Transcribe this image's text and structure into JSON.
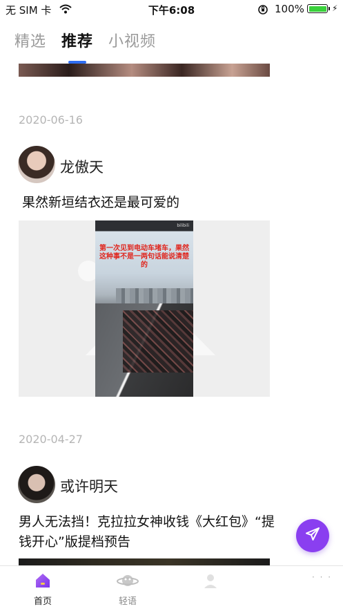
{
  "status_bar": {
    "carrier": "无 SIM 卡",
    "time": "下午6:08",
    "battery_percent": "100%",
    "battery_level": 1.0,
    "colors": {
      "battery": "#3ad13c"
    },
    "icons": [
      "wifi-icon",
      "rotation-lock-icon",
      "battery-icon",
      "charging-bolt-icon"
    ]
  },
  "top_tabs": [
    {
      "label": "精选",
      "active": false
    },
    {
      "label": "推荐",
      "active": true
    },
    {
      "label": "小视频",
      "active": false
    }
  ],
  "feed": {
    "posts": [
      {
        "date": "2020-06-16",
        "username": "龙傲天",
        "caption": "果然新垣结衣还是最可爱的",
        "media_overlay_text": "第一次见到电动车堵车，果然这种事不是一两句话能说清楚的",
        "media_watermark": "bilibili"
      },
      {
        "date": "2020-04-27",
        "username": "或许明天",
        "caption": "男人无法挡！克拉拉女神收钱《大红包》“提钱开心”版提档预告"
      }
    ]
  },
  "fab": {
    "icon": "send-plane-icon",
    "color": "#8a3ff0"
  },
  "bottom_nav": [
    {
      "label": "首页",
      "icon": "home-icon",
      "active": true
    },
    {
      "label": "轻语",
      "icon": "planet-icon",
      "active": false
    },
    {
      "label": "",
      "icon": "profile-icon",
      "active": false
    }
  ],
  "colors": {
    "accent": "#2f6ef2",
    "brand_purple": "#8a3ff0"
  }
}
